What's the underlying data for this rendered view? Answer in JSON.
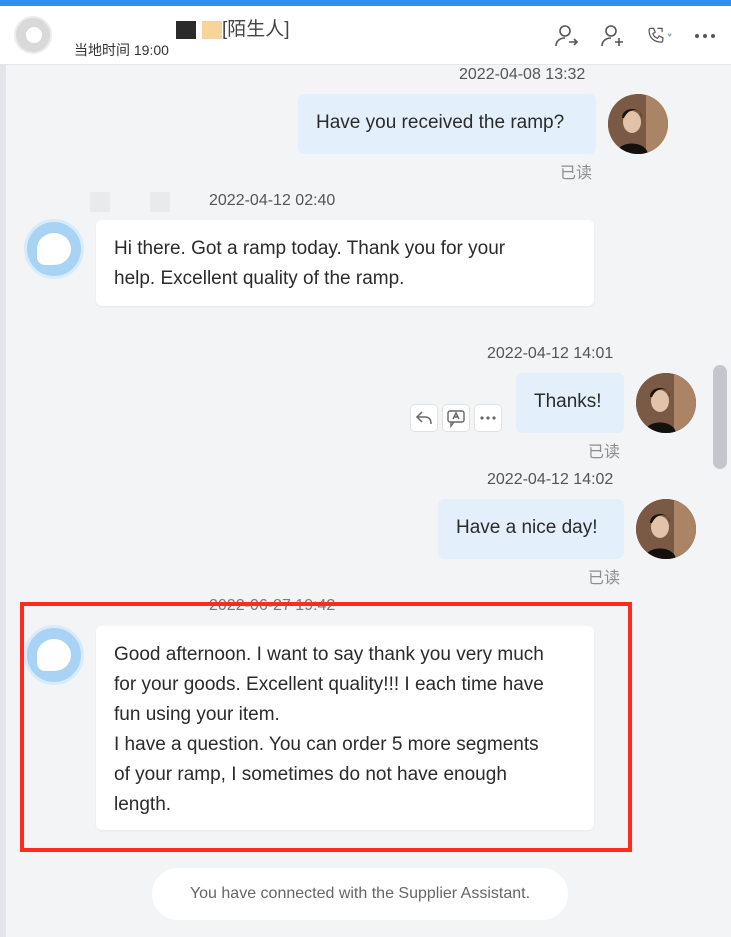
{
  "header": {
    "contact_name_visible": "[陌生人]",
    "local_time_label": "当地时间 19:00",
    "actions": [
      "contact-transfer-icon",
      "add-contact-icon",
      "call-icon",
      "more-icon"
    ]
  },
  "messages": [
    {
      "id": "m1",
      "direction": "out",
      "timestamp": "2022-04-08 13:32",
      "text": "Have you received the ramp?",
      "status": "已读"
    },
    {
      "id": "m2",
      "direction": "in",
      "timestamp": "2022-04-12 02:40",
      "lines": [
        "Hi there. Got a ramp today. Thank you for your",
        "help. Excellent quality of the ramp."
      ]
    },
    {
      "id": "m3",
      "direction": "out",
      "timestamp": "2022-04-12 14:01",
      "text": "Thanks!",
      "status": "已读"
    },
    {
      "id": "m4",
      "direction": "out",
      "timestamp": "2022-04-12 14:02",
      "text": "Have a nice day!",
      "status": "已读"
    },
    {
      "id": "m5",
      "direction": "in",
      "timestamp": "2022-06-27 19:42",
      "lines": [
        "Good afternoon. I want to say thank you very much",
        "for your goods. Excellent quality!!! I each time have",
        "fun using your item.",
        "I have a question. You can order 5 more segments",
        "of your ramp, I sometimes do not have enough",
        "length."
      ]
    }
  ],
  "message_tools": [
    "reply-icon",
    "translate-icon",
    "more-options-icon"
  ],
  "system_notice": "You have connected with the Supplier Assistant.",
  "colors": {
    "accent": "#2f8ff0",
    "outgoing_bubble": "#e3f0fc",
    "highlight_border": "#ff2b1c"
  }
}
